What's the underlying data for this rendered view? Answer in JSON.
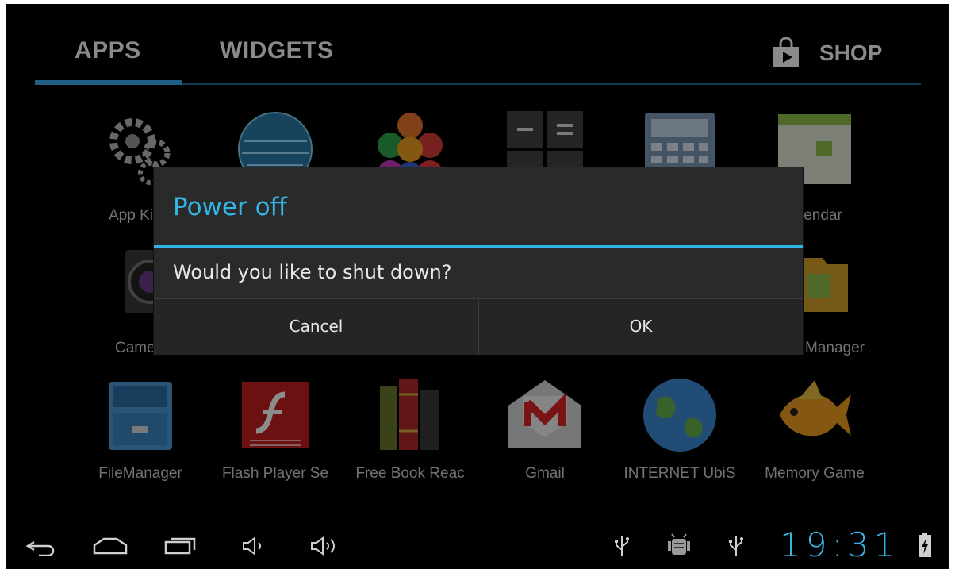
{
  "tabs": {
    "apps": "APPS",
    "widgets": "WIDGETS",
    "shop": "SHOP"
  },
  "apps_row1": [
    "App Ki",
    "",
    "",
    "",
    "",
    "lendar"
  ],
  "apps_row2": [
    "Came",
    "Manager"
  ],
  "apps_row3": [
    "FileManager",
    "Flash Player Se",
    "Free Book Reac",
    "Gmail",
    "INTERNET UbiS",
    "Memory Game"
  ],
  "dialog": {
    "title": "Power off",
    "message": "Would you like to shut down?",
    "cancel": "Cancel",
    "ok": "OK"
  },
  "status": {
    "time": "19:31"
  },
  "colors": {
    "accent": "#33b5e5",
    "background": "#000000",
    "dialog_bg": "#2a2a2a"
  },
  "icons": [
    "back-icon",
    "home-icon",
    "recents-icon",
    "volume-down-icon",
    "volume-up-icon",
    "usb-icon",
    "android-debug-icon",
    "usb-icon",
    "battery-charging-icon",
    "shop-bag-icon"
  ]
}
